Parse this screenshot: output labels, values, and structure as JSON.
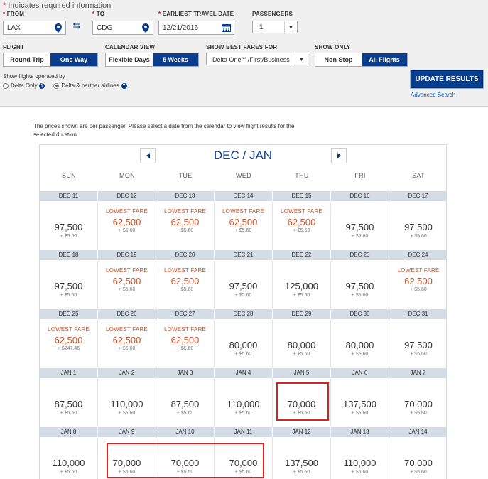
{
  "required_note": "Indicates required information",
  "search": {
    "from_label": "FROM",
    "from_value": "LAX",
    "to_label": "TO",
    "to_value": "CDG",
    "date_label": "EARLIEST TRAVEL DATE",
    "date_value": "12/21/2016",
    "passengers_label": "PASSENGERS",
    "passengers_value": "1",
    "flight_label": "FLIGHT",
    "flight_options": [
      "Round Trip",
      "One Way"
    ],
    "flight_selected": "One Way",
    "calendar_label": "CALENDAR VIEW",
    "calendar_options": [
      "Flexible Days",
      "5 Weeks"
    ],
    "calendar_selected": "5 Weeks",
    "fares_label": "SHOW BEST FARES FOR",
    "fares_value": "Delta One℠/First/Business",
    "show_only_label": "SHOW ONLY",
    "show_only_options": [
      "Non Stop",
      "All Flights"
    ],
    "show_only_selected": "All Flights",
    "operated_label": "Show flights operated by",
    "operated_options": [
      "Delta Only",
      "Delta & partner airlines"
    ],
    "operated_selected": "Delta & partner airlines",
    "update_label": "UPDATE RESULTS",
    "advanced_label": "Advanced Search"
  },
  "intro_text": "The prices shown are per passenger. Please select a date from the calendar to view flight results for the selected duration.",
  "calendar": {
    "month_label": "DEC / JAN",
    "days_of_week": [
      "SUN",
      "MON",
      "TUE",
      "WED",
      "THU",
      "FRI",
      "SAT"
    ],
    "lowest_label": "LOWEST FARE",
    "weeks": [
      {
        "dates": [
          "DEC 11",
          "DEC 12",
          "DEC 13",
          "DEC 14",
          "DEC 15",
          "DEC 16",
          "DEC 17"
        ],
        "miles": [
          "97,500",
          "62,500",
          "62,500",
          "62,500",
          "62,500",
          "97,500",
          "97,500"
        ],
        "taxes": [
          "+ $5.60",
          "+ $5.60",
          "+ $5.60",
          "+ $5.60",
          "+ $5.60",
          "+ $5.60",
          "+ $5.60"
        ],
        "lowest": [
          false,
          true,
          true,
          true,
          true,
          false,
          false
        ]
      },
      {
        "dates": [
          "DEC 18",
          "DEC 19",
          "DEC 20",
          "DEC 21",
          "DEC 22",
          "DEC 23",
          "DEC 24"
        ],
        "miles": [
          "97,500",
          "62,500",
          "62,500",
          "97,500",
          "125,000",
          "97,500",
          "62,500"
        ],
        "taxes": [
          "+ $5.60",
          "+ $5.60",
          "+ $5.60",
          "+ $5.60",
          "+ $5.60",
          "+ $5.60",
          "+ $5.60"
        ],
        "lowest": [
          false,
          true,
          true,
          false,
          false,
          false,
          true
        ]
      },
      {
        "dates": [
          "DEC 25",
          "DEC 26",
          "DEC 27",
          "DEC 28",
          "DEC 29",
          "DEC 30",
          "DEC 31"
        ],
        "miles": [
          "62,500",
          "62,500",
          "62,500",
          "80,000",
          "80,000",
          "80,000",
          "97,500"
        ],
        "taxes": [
          "+ $247.46",
          "+ $5.60",
          "+ $5.60",
          "+ $5.60",
          "+ $5.60",
          "+ $5.60",
          "+ $5.60"
        ],
        "lowest": [
          true,
          true,
          true,
          false,
          false,
          false,
          false
        ]
      },
      {
        "dates": [
          "JAN 1",
          "JAN 2",
          "JAN 3",
          "JAN 4",
          "JAN 5",
          "JAN 6",
          "JAN 7"
        ],
        "miles": [
          "87,500",
          "110,000",
          "87,500",
          "110,000",
          "70,000",
          "137,500",
          "70,000"
        ],
        "taxes": [
          "+ $5.60",
          "+ $5.60",
          "+ $5.60",
          "+ $5.60",
          "+ $5.60",
          "+ $5.60",
          "+ $5.60"
        ],
        "lowest": [
          false,
          false,
          false,
          false,
          false,
          false,
          false
        ]
      },
      {
        "dates": [
          "JAN 8",
          "JAN 9",
          "JAN 10",
          "JAN 11",
          "JAN 12",
          "JAN 13",
          "JAN 14"
        ],
        "miles": [
          "110,000",
          "70,000",
          "70,000",
          "70,000",
          "137,500",
          "110,000",
          "70,000"
        ],
        "taxes": [
          "+ $5.60",
          "+ $5.60",
          "+ $5.60",
          "+ $5.60",
          "+ $5.60",
          "+ $5.60",
          "+ $5.60"
        ],
        "lowest": [
          false,
          false,
          false,
          false,
          false,
          false,
          false
        ]
      }
    ]
  },
  "colors": {
    "brand_blue": "#0a3e8c",
    "lowest_fare": "#c6532c",
    "highlight_box": "#e01e1e"
  }
}
